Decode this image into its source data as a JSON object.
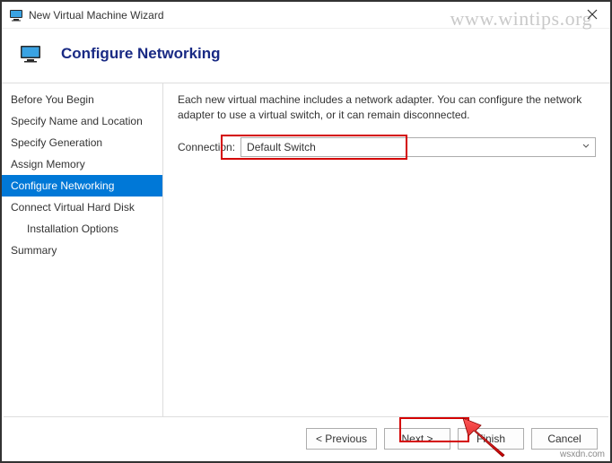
{
  "window": {
    "title": "New Virtual Machine Wizard"
  },
  "watermark": "www.wintips.org",
  "wsxdn": "wsxdn.com",
  "header": {
    "title": "Configure Networking"
  },
  "sidebar": {
    "items": [
      {
        "label": "Before You Begin"
      },
      {
        "label": "Specify Name and Location"
      },
      {
        "label": "Specify Generation"
      },
      {
        "label": "Assign Memory"
      },
      {
        "label": "Configure Networking"
      },
      {
        "label": "Connect Virtual Hard Disk"
      },
      {
        "label": "Installation Options"
      },
      {
        "label": "Summary"
      }
    ]
  },
  "main": {
    "description": "Each new virtual machine includes a network adapter. You can configure the network adapter to use a virtual switch, or it can remain disconnected.",
    "connection_label": "Connection:",
    "connection_value": "Default Switch"
  },
  "footer": {
    "previous": "< Previous",
    "next": "Next >",
    "finish": "Finish",
    "cancel": "Cancel"
  }
}
